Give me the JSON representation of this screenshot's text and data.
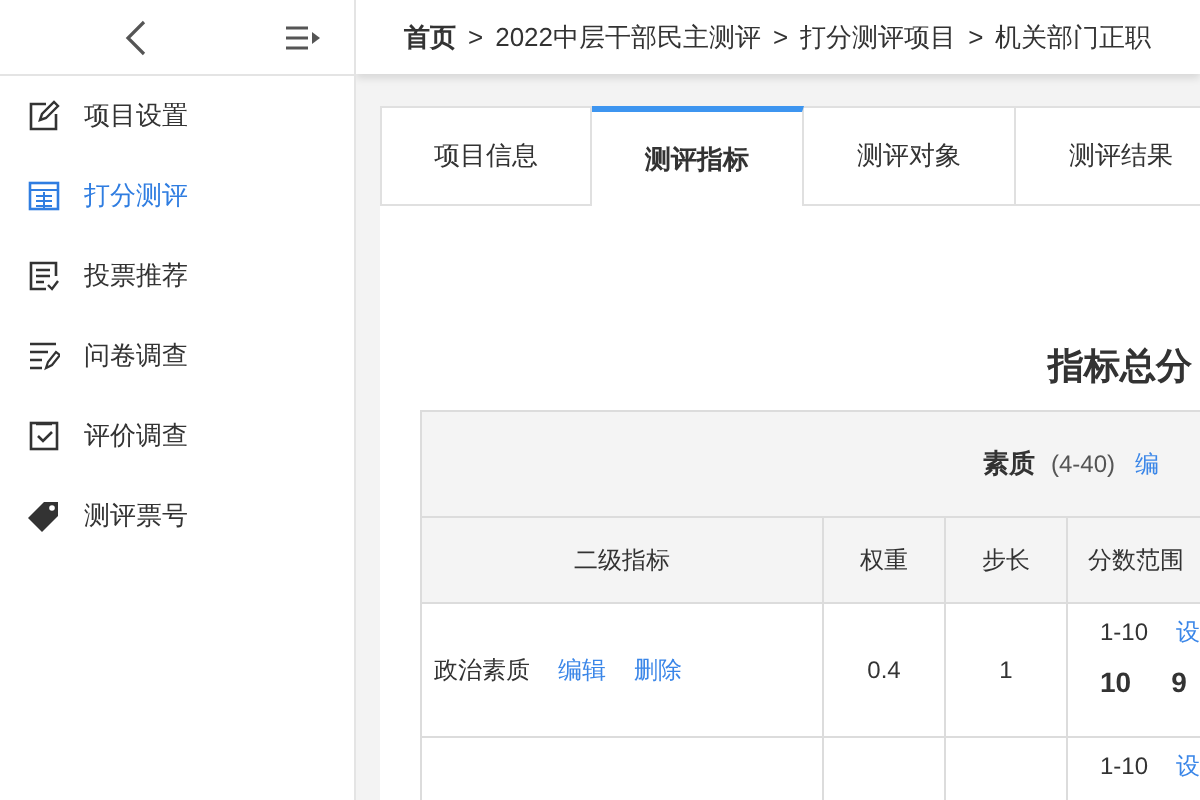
{
  "sidebar": {
    "items": [
      {
        "label": "项目设置",
        "selected": false
      },
      {
        "label": "打分测评",
        "selected": true
      },
      {
        "label": "投票推荐",
        "selected": false
      },
      {
        "label": "问卷调查",
        "selected": false
      },
      {
        "label": "评价调查",
        "selected": false
      },
      {
        "label": "测评票号",
        "selected": false
      }
    ]
  },
  "breadcrumb": {
    "separator": ">",
    "items": [
      "首页",
      "2022中层干部民主测评",
      "打分测评项目",
      "机关部门正职"
    ]
  },
  "tabs": [
    {
      "label": "项目信息",
      "selected": false
    },
    {
      "label": "测评指标",
      "selected": true
    },
    {
      "label": "测评对象",
      "selected": false
    },
    {
      "label": "测评结果",
      "selected": false
    }
  ],
  "section_title": "指标总分",
  "table": {
    "group": {
      "name": "素质",
      "range": "(4-40)",
      "action": "编"
    },
    "columns": [
      "二级指标",
      "权重",
      "步长",
      "分数范围"
    ],
    "rows": [
      {
        "name": "政治素质",
        "actions": [
          "编辑",
          "删除"
        ],
        "weight": "0.4",
        "step": "1",
        "range": "1-10",
        "range_action": "设",
        "scores": [
          "10",
          "9"
        ]
      },
      {
        "range": "1-10",
        "range_action": "设"
      }
    ]
  }
}
